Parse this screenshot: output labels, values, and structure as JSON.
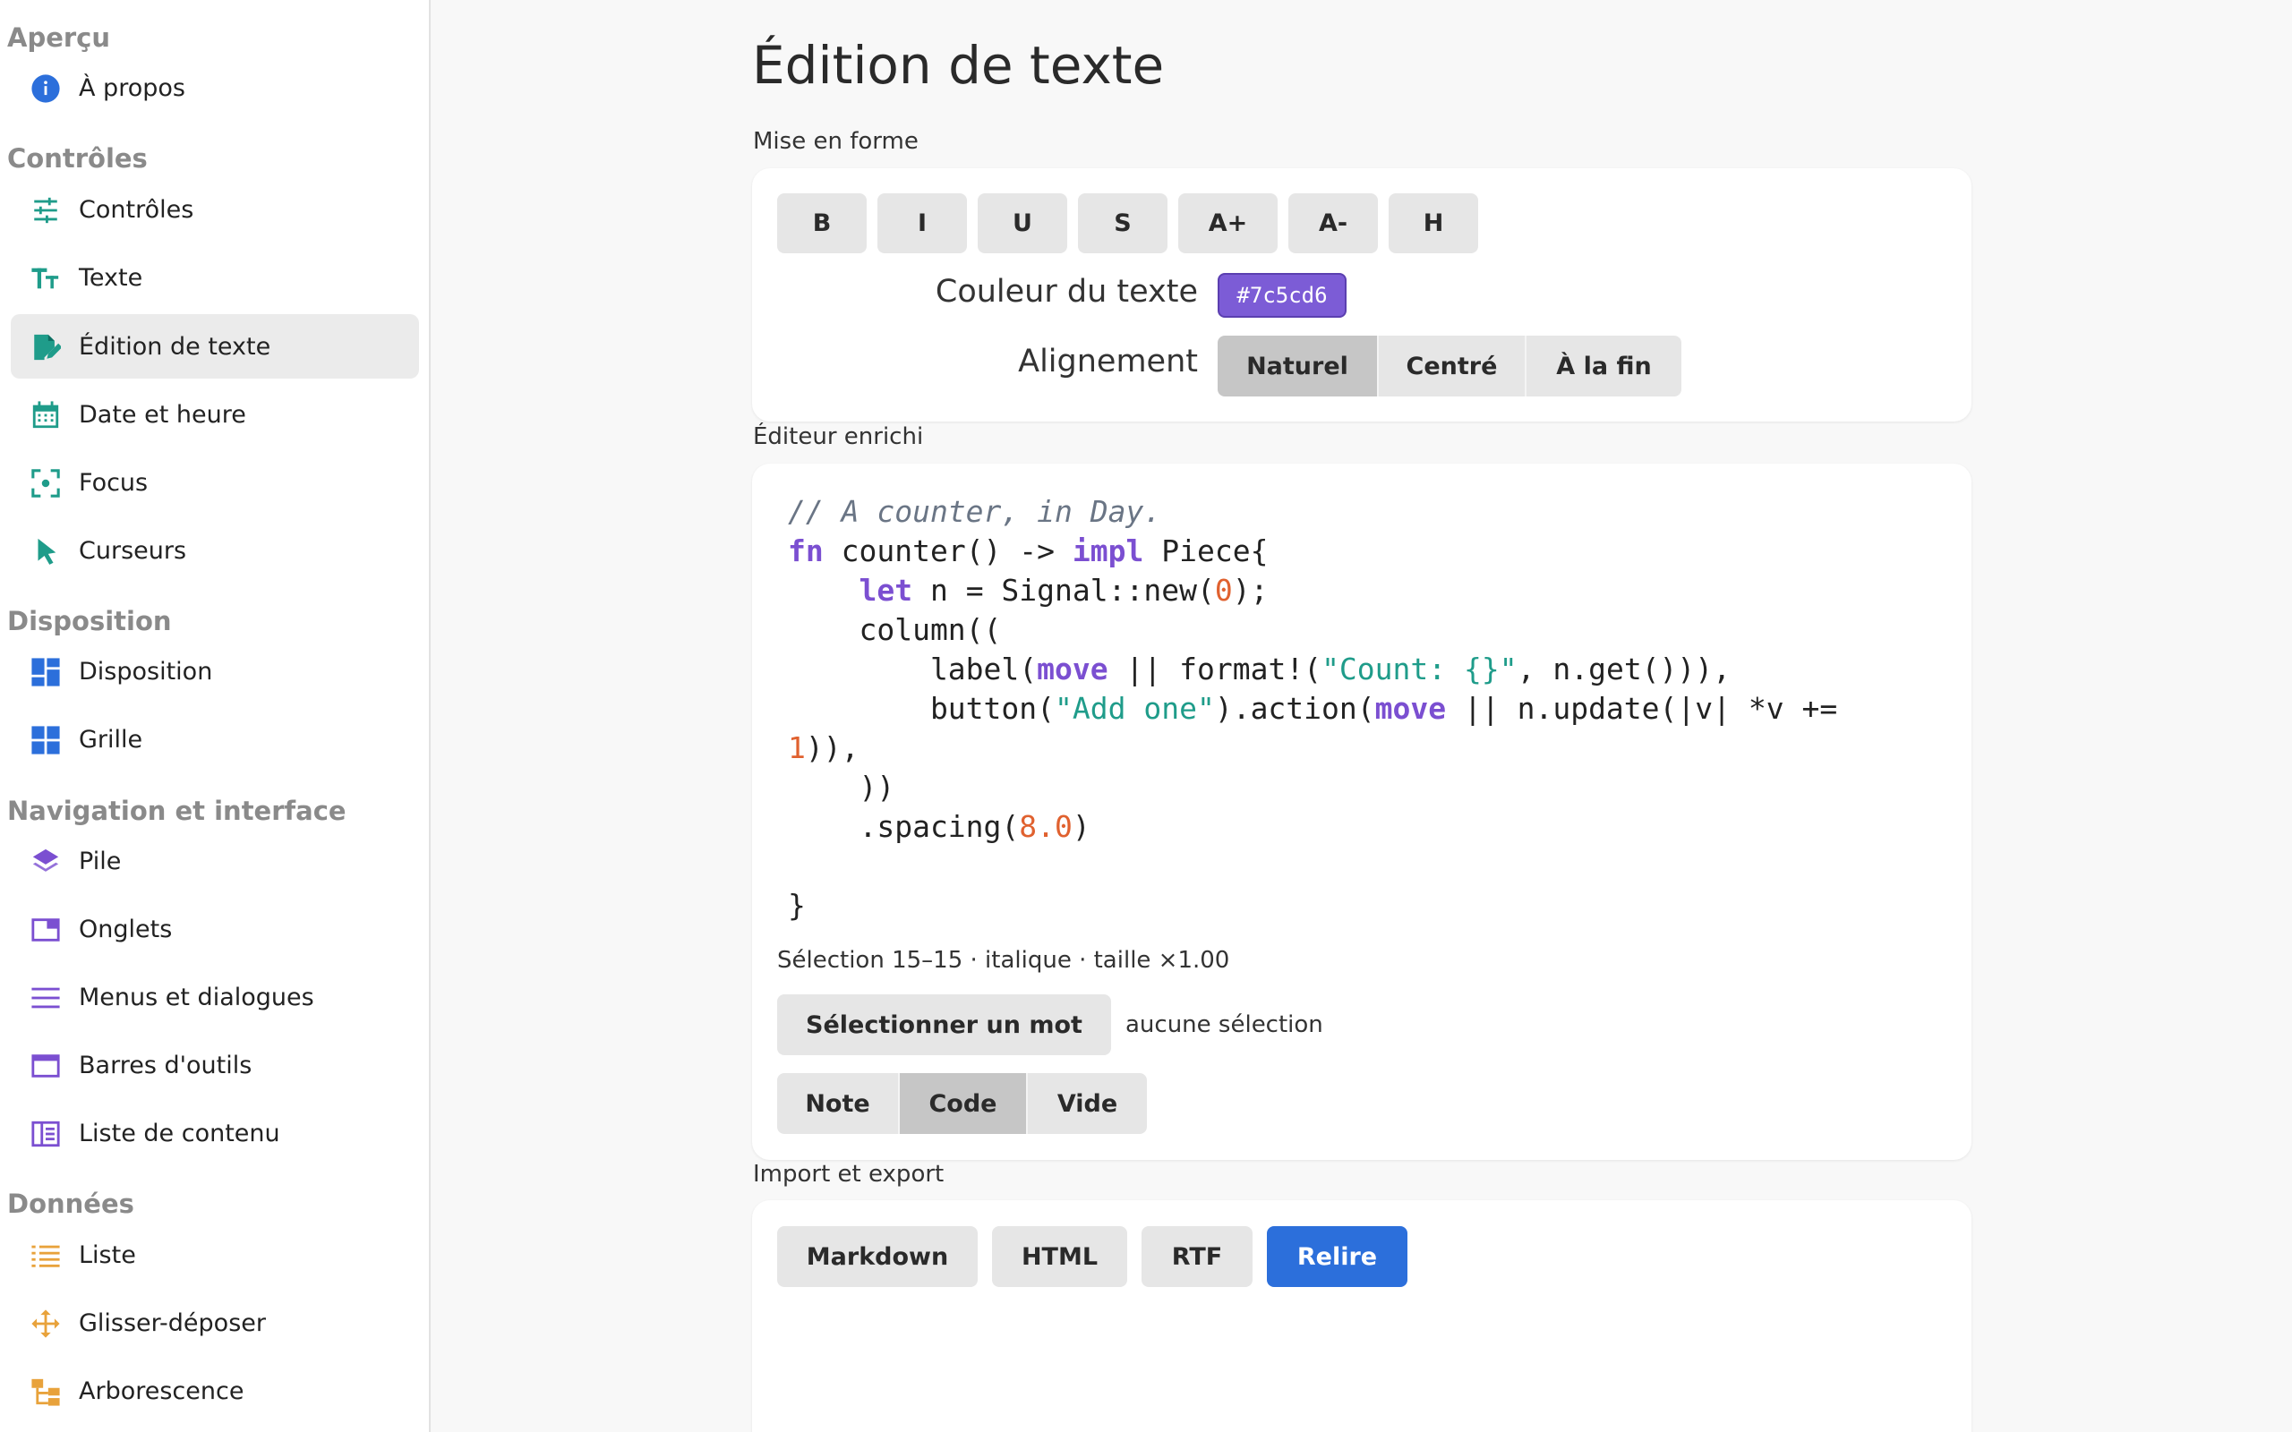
{
  "sidebar": {
    "sections": [
      {
        "title": "Aperçu",
        "items": [
          {
            "label": "À propos",
            "icon": "info-icon",
            "color": "#2c6fdb",
            "active": false
          }
        ]
      },
      {
        "title": "Contrôles",
        "items": [
          {
            "label": "Contrôles",
            "icon": "sliders-icon",
            "color": "#1f9c8a",
            "active": false
          },
          {
            "label": "Texte",
            "icon": "text-size-icon",
            "color": "#1f9c8a",
            "active": false
          },
          {
            "label": "Édition de texte",
            "icon": "edit-document-icon",
            "color": "#1f9c8a",
            "active": true
          },
          {
            "label": "Date et heure",
            "icon": "calendar-icon",
            "color": "#1f9c8a",
            "active": false
          },
          {
            "label": "Focus",
            "icon": "focus-icon",
            "color": "#1f9c8a",
            "active": false
          },
          {
            "label": "Curseurs",
            "icon": "cursor-icon",
            "color": "#1f9c8a",
            "active": false
          }
        ]
      },
      {
        "title": "Disposition",
        "items": [
          {
            "label": "Disposition",
            "icon": "dashboard-icon",
            "color": "#2c6fdb",
            "active": false
          },
          {
            "label": "Grille",
            "icon": "grid-icon",
            "color": "#2c6fdb",
            "active": false
          }
        ]
      },
      {
        "title": "Navigation et interface",
        "items": [
          {
            "label": "Pile",
            "icon": "layers-icon",
            "color": "#7b4fd1",
            "active": false
          },
          {
            "label": "Onglets",
            "icon": "tab-icon",
            "color": "#7b4fd1",
            "active": false
          },
          {
            "label": "Menus et dialogues",
            "icon": "menu-icon",
            "color": "#7b4fd1",
            "active": false
          },
          {
            "label": "Barres d'outils",
            "icon": "window-icon",
            "color": "#7b4fd1",
            "active": false
          },
          {
            "label": "Liste de contenu",
            "icon": "book-icon",
            "color": "#7b4fd1",
            "active": false
          }
        ]
      },
      {
        "title": "Données",
        "items": [
          {
            "label": "Liste",
            "icon": "list-icon",
            "color": "#e8a23b",
            "active": false
          },
          {
            "label": "Glisser-déposer",
            "icon": "move-icon",
            "color": "#e8a23b",
            "active": false
          },
          {
            "label": "Arborescence",
            "icon": "tree-icon",
            "color": "#e8a23b",
            "active": false
          }
        ]
      }
    ]
  },
  "main": {
    "title": "Édition de texte",
    "formatting": {
      "label": "Mise en forme",
      "buttons": [
        "B",
        "I",
        "U",
        "S",
        "A+",
        "A-",
        "H"
      ],
      "color_label": "Couleur du texte",
      "color_value": "#7c5cd6",
      "align_label": "Alignement",
      "align_options": [
        "Naturel",
        "Centré",
        "À la fin"
      ],
      "align_selected": 0
    },
    "editor": {
      "label": "Éditeur enrichi",
      "status": "Sélection 15–15 · italique · taille ×1.00",
      "select_word_label": "Sélectionner un mot",
      "selection_text": "aucune sélection",
      "modes": [
        "Note",
        "Code",
        "Vide"
      ],
      "mode_selected": 1
    },
    "io": {
      "label": "Import et export",
      "buttons": [
        "Markdown",
        "HTML",
        "RTF"
      ],
      "primary": "Relire"
    }
  },
  "colors": {
    "accent": "#2c6fdb",
    "keyword": "#7b4fd1",
    "string": "#1f9c8a",
    "number": "#e0612f",
    "comment": "#6a7585"
  }
}
